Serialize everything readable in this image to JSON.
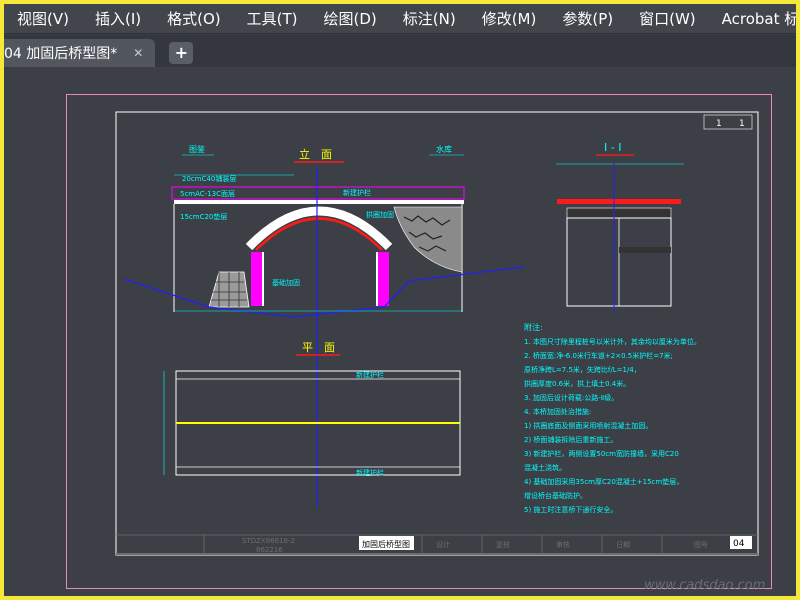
{
  "menu": [
    "视图(V)",
    "插入(I)",
    "格式(O)",
    "工具(T)",
    "绘图(D)",
    "标注(N)",
    "修改(M)",
    "参数(P)",
    "窗口(W)",
    "Acrobat 标"
  ],
  "tab": {
    "title": "04 加固后桥型图*",
    "close": "✕",
    "add": "+"
  },
  "drawing": {
    "elevation_title": "立　面",
    "plan_title": "平　面",
    "section_title": "I - I",
    "left_label": "图鉴",
    "right_label": "水库",
    "layer1": "20cmC40铺装层",
    "layer2": "5cmAC-13C面层",
    "layer3": "15cmC20垫层",
    "note_rail": "新建护栏",
    "note_arch": "拱圈加固",
    "note_base": "基础加固",
    "plan_top": "新建护栏",
    "plan_bottom": "新建护栏",
    "sheet_page": "1",
    "sheet_total": "1",
    "notes_title": "附注:",
    "notes": [
      "1. 本图尺寸除里程桩号以米计外，其余均以厘米为单位。",
      "2. 桥面宽:净-6.0米行车道+2×0.5米护栏=7米;",
      "   原桥净跨L=7.5米，矢跨比f/L=1/4，",
      "   拱圈厚度0.6米，拱上填土0.4米。",
      "3. 加固后设计荷载:公路-Ⅱ级。",
      "4. 本桥加固处治措施:",
      "   1) 拱圈底面及侧面采用喷射混凝土加固。",
      "   2) 桥面铺装拆除后重新施工。",
      "   3) 新建护栏，两侧设置50cm宽防撞墙，采用C20",
      "      混凝土浇筑。",
      "   4) 基础加固采用35cm厚C20混凝土+15cm垫层，",
      "      增设桥台基础防护。",
      "   5) 施工时注意桥下通行安全。"
    ],
    "title_block": {
      "drawing_name": "加固后桥型图",
      "drawing_number": "04",
      "project_code": "STDZX86618-2",
      "project_sub": "862216",
      "cells": [
        "设计",
        "复核",
        "审核",
        "日期",
        "图号"
      ]
    },
    "watermark": "www.cadsdao.com"
  },
  "colors": {
    "menu_bg": "#42454c",
    "canvas_bg": "#3c3f46",
    "outer_frame": "#f4e83a",
    "paper_border": "#e58cb0",
    "line_white": "#ffffff",
    "line_blue": "#2020ff",
    "accent_red": "#ff1a1a",
    "accent_magenta": "#ff00ff",
    "accent_cyan": "#00ffff",
    "accent_yellow": "#ffff00"
  }
}
